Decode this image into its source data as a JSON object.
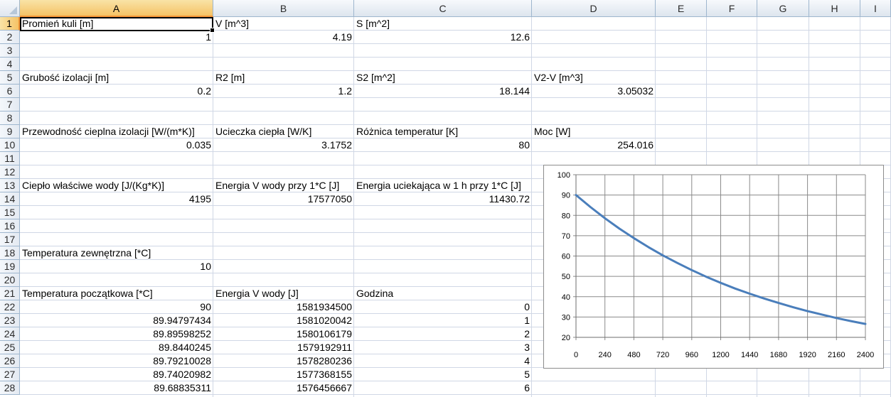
{
  "columns": [
    "A",
    "B",
    "C",
    "D",
    "E",
    "F",
    "G",
    "H",
    "I"
  ],
  "rows": [
    "1",
    "2",
    "3",
    "4",
    "5",
    "6",
    "7",
    "8",
    "9",
    "10",
    "11",
    "12",
    "13",
    "14",
    "15",
    "16",
    "17",
    "18",
    "19",
    "20",
    "21",
    "22",
    "23",
    "24",
    "25",
    "26",
    "27",
    "28"
  ],
  "cells": {
    "A1": "Promień kuli [m]",
    "B1": "V [m^3]",
    "C1": "S [m^2]",
    "A2": "1",
    "B2": "4.19",
    "C2": "12.6",
    "A5": "Grubość izolacji [m]",
    "B5": "R2 [m]",
    "C5": "S2 [m^2]",
    "D5": "V2-V [m^3]",
    "A6": "0.2",
    "B6": "1.2",
    "C6": "18.144",
    "D6": "3.05032",
    "A9": "Przewodność cieplna izolacji [W/(m*K)]",
    "B9": "Ucieczka ciepła [W/K]",
    "C9": "Różnica temperatur [K]",
    "D9": "Moc [W]",
    "A10": "0.035",
    "B10": "3.1752",
    "C10": "80",
    "D10": "254.016",
    "A13": "Ciepło właściwe wody [J/(Kg*K)]",
    "B13": "Energia V wody przy 1*C [J]",
    "C13": "Energia uciekająca w 1 h przy 1*C [J]",
    "A14": "4195",
    "B14": "17577050",
    "C14": "11430.72",
    "A18": "Temperatura zewnętrzna [*C]",
    "A19": "10",
    "A21": "Temperatura początkowa [*C]",
    "B21": "Energia V wody [J]",
    "C21": "Godzina",
    "A22": "90",
    "B22": "1581934500",
    "C22": "0",
    "A23": "89.94797434",
    "B23": "1581020042",
    "C23": "1",
    "A24": "89.89598252",
    "B24": "1580106179",
    "C24": "2",
    "A25": "89.8440245",
    "B25": "1579192911",
    "C25": "3",
    "A26": "89.79210028",
    "B26": "1578280236",
    "C26": "4",
    "A27": "89.74020982",
    "B27": "1577368155",
    "C27": "5",
    "A28": "89.68835311",
    "B28": "1576456667",
    "C28": "6"
  },
  "numeric_cells": [
    "A2",
    "B2",
    "C2",
    "A6",
    "B6",
    "C6",
    "D6",
    "A10",
    "B10",
    "C10",
    "D10",
    "A14",
    "B14",
    "C14",
    "A19",
    "A22",
    "B22",
    "C22",
    "A23",
    "B23",
    "C23",
    "A24",
    "B24",
    "C24",
    "A25",
    "B25",
    "C25",
    "A26",
    "B26",
    "C26",
    "A27",
    "B27",
    "C27",
    "A28",
    "B28",
    "C28"
  ],
  "active_cell": "A1",
  "selection_color": "#f5c366",
  "grid_color": "#d0d7e5",
  "chart_data": {
    "type": "line",
    "title": "",
    "xlabel": "",
    "ylabel": "",
    "xlim": [
      0,
      2400
    ],
    "ylim": [
      20,
      100
    ],
    "x_ticks": [
      "0",
      "240",
      "480",
      "720",
      "960",
      "1200",
      "1440",
      "1680",
      "1920",
      "2160",
      "2400"
    ],
    "y_ticks": [
      "20",
      "30",
      "40",
      "50",
      "60",
      "70",
      "80",
      "90",
      "100"
    ],
    "grid": true,
    "legend": "none",
    "series_color": "#4a7ebb",
    "series": [
      {
        "x": [
          0,
          120,
          240,
          360,
          480,
          600,
          720,
          840,
          960,
          1080,
          1200,
          1320,
          1440,
          1560,
          1680,
          1800,
          1920,
          2040,
          2160,
          2280,
          2400
        ],
        "values": [
          90,
          84.1,
          78.6,
          73.5,
          68.8,
          64.4,
          60.3,
          56.6,
          53.1,
          49.8,
          46.8,
          44.0,
          41.5,
          39.1,
          36.9,
          34.8,
          32.9,
          31.2,
          29.5,
          28.0,
          26.6
        ]
      }
    ]
  }
}
